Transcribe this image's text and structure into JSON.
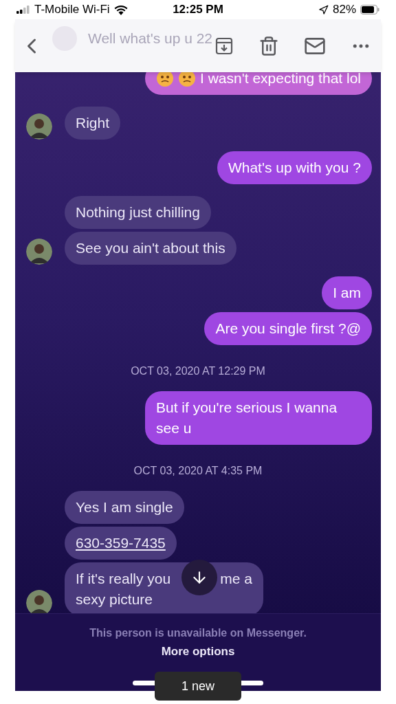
{
  "status_bar": {
    "carrier": "T-Mobile Wi-Fi",
    "time": "12:25 PM",
    "battery": "82%"
  },
  "header": {
    "faded_title": "Well what's up u 22"
  },
  "messages": [
    {
      "kind": "message",
      "outgoing": true,
      "icons": [
        {
          "kind": "face"
        },
        {
          "kind": "face"
        }
      ],
      "parts": [
        "I wasn't expecting that lol"
      ]
    },
    {
      "kind": "message",
      "outgoing": false,
      "avatar": true,
      "parts": [
        "Right"
      ]
    },
    {
      "kind": "message",
      "outgoing": true,
      "parts": [
        "What's up with you ?"
      ]
    },
    {
      "kind": "message",
      "outgoing": false,
      "avatar": false,
      "parts": [
        "Nothing just chilling"
      ]
    },
    {
      "kind": "message",
      "outgoing": false,
      "avatar": true,
      "parts": [
        "See you ain't about this"
      ]
    },
    {
      "kind": "message",
      "outgoing": true,
      "parts": [
        "I am"
      ]
    },
    {
      "kind": "message",
      "outgoing": true,
      "parts": [
        "Are you single first ?@"
      ]
    },
    {
      "kind": "timestamp",
      "text": "OCT 03, 2020 AT 12:29 PM"
    },
    {
      "kind": "message",
      "outgoing": true,
      "parts": [
        "But if you're serious I wanna see u"
      ]
    },
    {
      "kind": "timestamp",
      "text": "OCT 03, 2020 AT 4:35 PM"
    },
    {
      "kind": "message",
      "outgoing": false,
      "avatar": false,
      "parts": [
        "Yes I am single"
      ]
    },
    {
      "kind": "message",
      "outgoing": false,
      "avatar": false,
      "link": true,
      "parts": [
        "630-359-7435"
      ]
    },
    {
      "kind": "covered_message",
      "outgoing": false,
      "avatar": true,
      "parts": [
        "If it's really you",
        "me a",
        "sexy picture"
      ]
    }
  ],
  "footer": {
    "notice": "This person is unavailable on Messenger.",
    "action": "More options"
  },
  "new_pill": "1 new"
}
